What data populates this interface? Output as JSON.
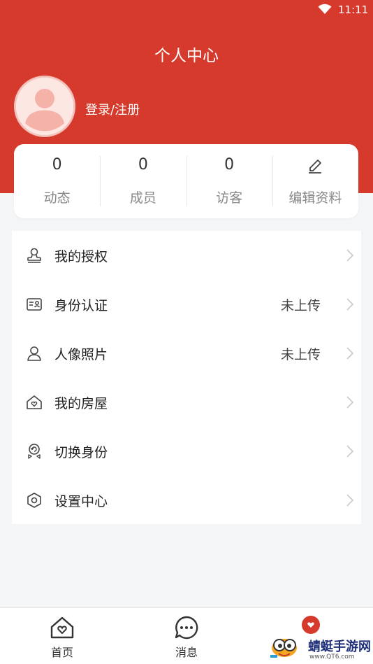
{
  "status_bar": {
    "time": "11:11"
  },
  "header": {
    "title": "个人中心",
    "login_label": "登录/注册"
  },
  "stats": [
    {
      "value": "0",
      "label": "动态"
    },
    {
      "value": "0",
      "label": "成员"
    },
    {
      "value": "0",
      "label": "访客"
    }
  ],
  "edit_profile": {
    "label": "编辑资料",
    "icon": "edit-icon"
  },
  "menu": [
    {
      "label": "我的授权",
      "value": "",
      "icon": "stamp-icon"
    },
    {
      "label": "身份认证",
      "value": "未上传",
      "icon": "id-card-icon"
    },
    {
      "label": "人像照片",
      "value": "未上传",
      "icon": "person-icon"
    },
    {
      "label": "我的房屋",
      "value": "",
      "icon": "house-icon"
    },
    {
      "label": "切换身份",
      "value": "",
      "icon": "switch-user-icon"
    },
    {
      "label": "设置中心",
      "value": "",
      "icon": "settings-icon"
    }
  ],
  "tabbar": [
    {
      "label": "首页",
      "icon": "home-icon"
    },
    {
      "label": "消息",
      "icon": "message-icon"
    },
    {
      "label": "",
      "icon": "profile-icon"
    }
  ],
  "watermark": {
    "text": "蜻蜓手游网",
    "sub": "www.QT6.com"
  },
  "colors": {
    "brand_red": "#d63a2c",
    "background": "#f4f5f7"
  }
}
